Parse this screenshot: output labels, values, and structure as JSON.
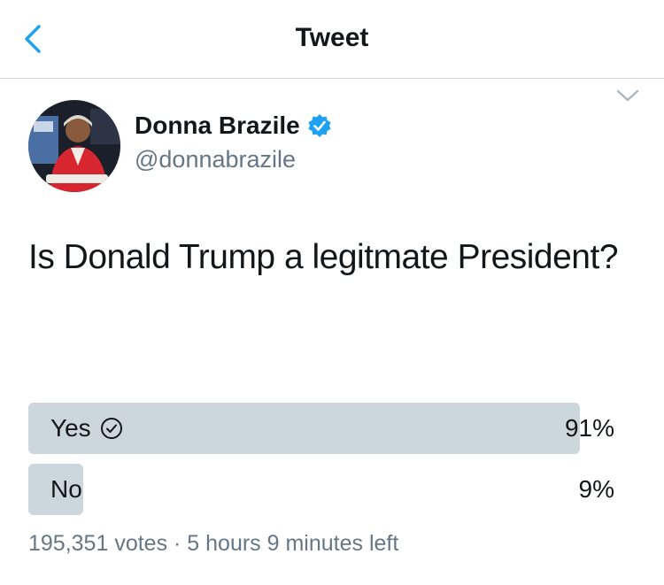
{
  "nav": {
    "title": "Tweet",
    "back_icon": "chevron-left-icon"
  },
  "author": {
    "name": "Donna Brazile",
    "handle": "@donnabrazile",
    "verified": true
  },
  "tweet": {
    "text": "Is Donald Trump a legitmate President?"
  },
  "poll": {
    "options": [
      {
        "label": "Yes",
        "percent_label": "91%",
        "percent": 91,
        "selected": true
      },
      {
        "label": "No",
        "percent_label": "9%",
        "percent": 9,
        "selected": false
      }
    ],
    "summary": "195,351 votes · 5 hours 9 minutes left"
  },
  "colors": {
    "accent": "#1da1f2",
    "poll_bar": "#ccd6dd",
    "secondary_text": "#657786"
  }
}
